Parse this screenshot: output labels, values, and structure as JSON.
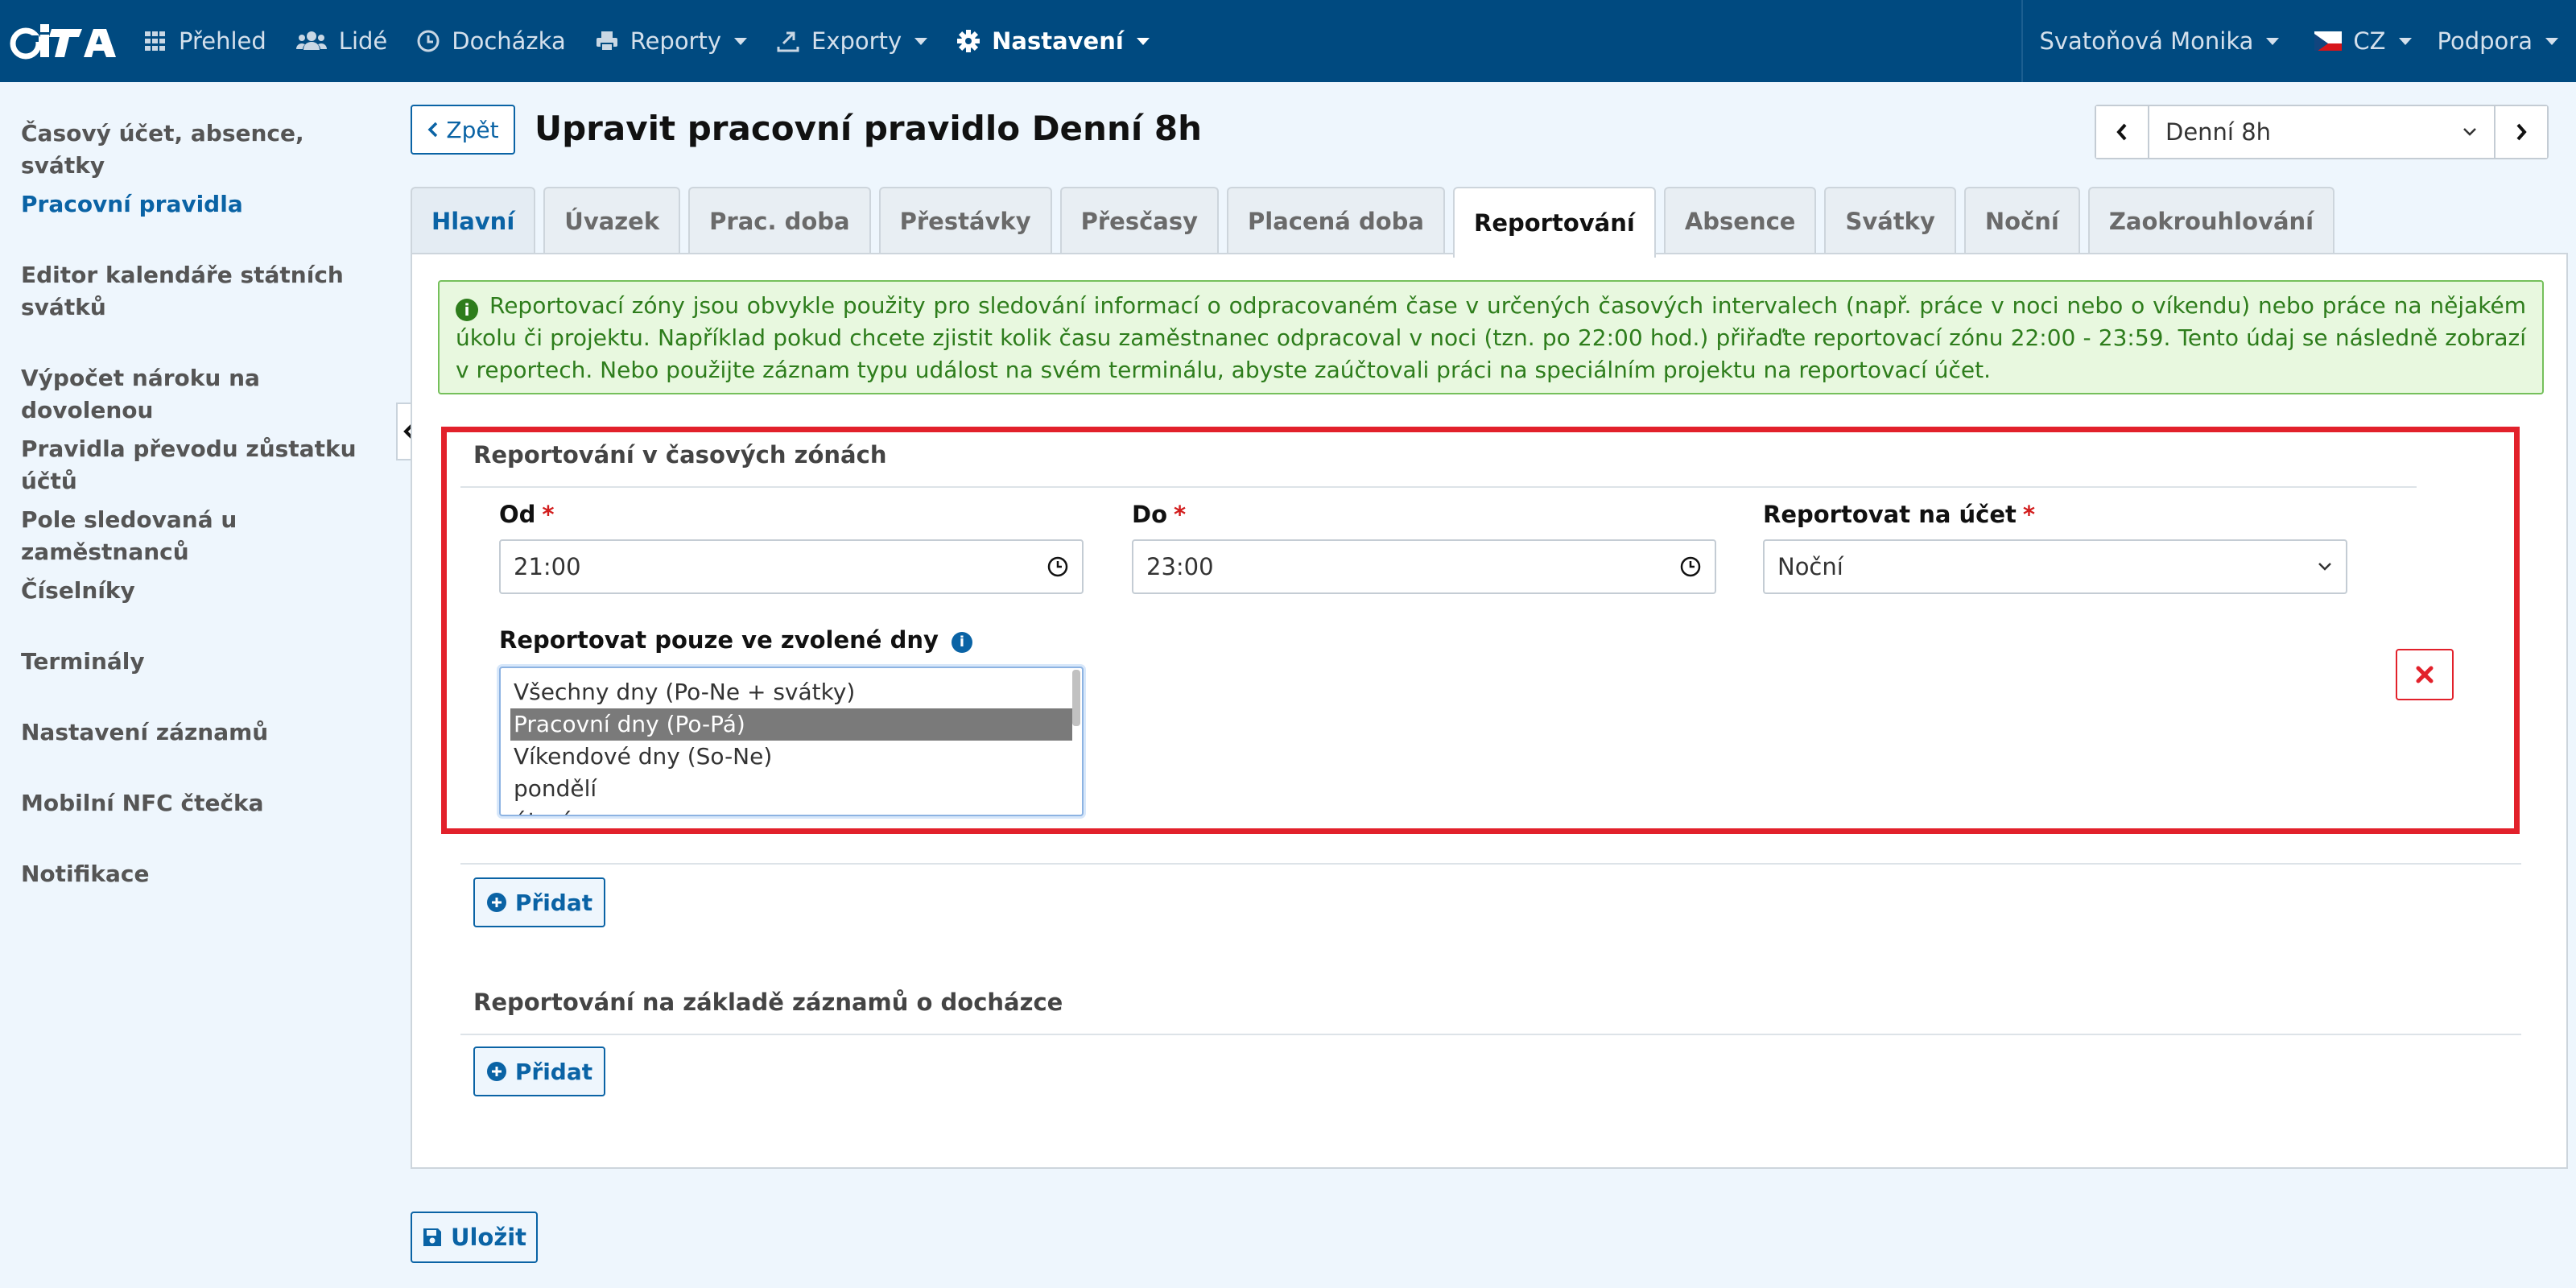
{
  "navbar": {
    "brand": "iTA",
    "items": [
      {
        "label": "Přehled",
        "icon": "grid-icon"
      },
      {
        "label": "Lidé",
        "icon": "users-icon"
      },
      {
        "label": "Docházka",
        "icon": "clock-icon"
      },
      {
        "label": "Reporty",
        "icon": "print-icon"
      },
      {
        "label": "Exporty",
        "icon": "export-icon"
      },
      {
        "label": "Nastavení",
        "icon": "gear-icon"
      }
    ],
    "user": "Svatoňová Monika",
    "language": "CZ",
    "support": "Podpora"
  },
  "sidebar": {
    "items": [
      {
        "label": "Časový účet, absence, svátky"
      },
      {
        "label": "Pracovní pravidla",
        "active": true
      },
      {
        "label": "Editor kalendáře státních svátků"
      },
      {
        "label": "Výpočet nároku na dovolenou"
      },
      {
        "label": "Pravidla převodu zůstatku účtů"
      },
      {
        "label": "Pole sledovaná u zaměstnanců"
      },
      {
        "label": "Číselníky"
      },
      {
        "label": "Terminály"
      },
      {
        "label": "Nastavení záznamů"
      },
      {
        "label": "Mobilní NFC čtečka"
      },
      {
        "label": "Notifikace"
      }
    ]
  },
  "header": {
    "back_label": "Zpět",
    "title": "Upravit pracovní pravidlo Denní 8h",
    "rule_selected": "Denní 8h"
  },
  "tabs": [
    "Hlavní",
    "Úvazek",
    "Prac. doba",
    "Přestávky",
    "Přesčasy",
    "Placená doba",
    "Reportování",
    "Absence",
    "Svátky",
    "Noční",
    "Zaokrouhlování"
  ],
  "active_tab": "Reportování",
  "info": {
    "text": "Reportovací zóny jsou obvykle použity pro sledování informací o odpracovaném čase v určených časových intervalech (např. práce v noci nebo o víkendu) nebo práce na nějakém úkolu či projektu. Například pokud chcete zjistit kolik času zaměstnanec odpracoval v noci (tzn. po 22:00 hod.) přiřaďte reportovací zónu 22:00 - 23:59. Tento údaj se následně zobrazí v reportech. Nebo použijte záznam typu událost na svém terminálu, abyste zaúčtovali práci na speciálním projektu na reportovací účet."
  },
  "time_zones": {
    "title": "Reportování v časových zónách",
    "from_label": "Od",
    "from_value": "21:00",
    "to_label": "Do",
    "to_value": "23:00",
    "account_label": "Reportovat na účet",
    "account_value": "Noční",
    "required_mark": "*",
    "days_label": "Reportovat pouze ve zvolené dny",
    "days_options": [
      "Všechny dny (Po-Ne + svátky)",
      "Pracovní dny (Po-Pá)",
      "Víkendové dny (So-Ne)",
      "pondělí",
      "úterý"
    ],
    "days_selected": "Pracovní dny (Po-Pá)",
    "add_label": "Přidat"
  },
  "records": {
    "title": "Reportování na základě záznamů o docházce",
    "add_label": "Přidat"
  },
  "save_label": "Uložit",
  "colors": {
    "navbar": "#004a80",
    "accent": "#0a63a5",
    "highlight": "#e2212b",
    "info_bg": "#e8f8df",
    "info_text": "#2e7d1c"
  }
}
